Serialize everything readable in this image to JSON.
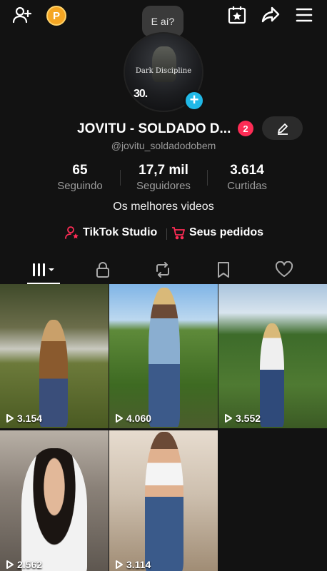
{
  "bubble_text": "E aí?",
  "coin_letter": "P",
  "avatar_text": "Dark Discipline",
  "avatar_number": "30.",
  "profile": {
    "name": "JOVITU - SOLDADO D...",
    "notification_count": "2",
    "handle": "@jovitu_soldadodobem",
    "bio": "Os melhores videos"
  },
  "stats": [
    {
      "value": "65",
      "label": "Seguindo"
    },
    {
      "value": "17,7 mil",
      "label": "Seguidores"
    },
    {
      "value": "3.614",
      "label": "Curtidas"
    }
  ],
  "links": {
    "studio": "TikTok Studio",
    "orders": "Seus pedidos"
  },
  "tabs": [
    "videos-grid",
    "private",
    "reposts",
    "favorites",
    "liked"
  ],
  "videos": [
    {
      "views": "3.154"
    },
    {
      "views": "4.060"
    },
    {
      "views": "3.552"
    },
    {
      "views": "2.562"
    },
    {
      "views": "3.114"
    }
  ],
  "colors": {
    "background": "#121212",
    "accent_red": "#fe2c55",
    "plus_blue": "#20b8e6",
    "coin": "#f5a623"
  }
}
